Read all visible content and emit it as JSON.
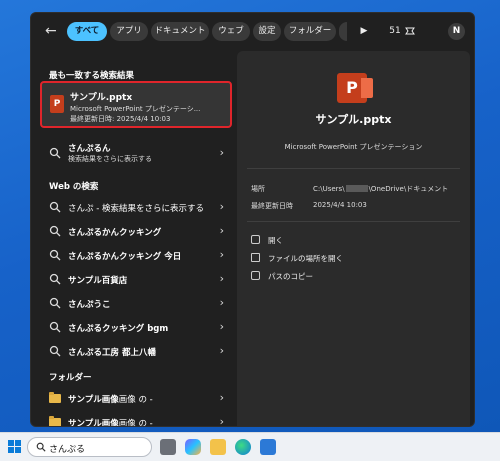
{
  "header": {
    "back_icon": "back-arrow-icon",
    "filters": [
      "すべて",
      "アプリ",
      "ドキュメント",
      "ウェブ",
      "設定",
      "フォルダー"
    ],
    "active_filter": "すべて",
    "points": "51",
    "avatar_initial": "N"
  },
  "best_match": {
    "heading": "最も一致する検索結果",
    "name": "サンプル.pptx",
    "type": "Microsoft PowerPoint プレゼンテーシ...",
    "modified": "最終更新日時: 2025/4/4 10:03"
  },
  "suggestion": {
    "query": "さんぷるん",
    "sub": "検索結果をさらに表示する"
  },
  "web": {
    "heading": "Web の検索",
    "items": [
      {
        "prefix": "さんぷ",
        "bold": "",
        "suffix": " - 検索結果をさらに表示する"
      },
      {
        "prefix": "",
        "bold": "さんぷるかんクッキング",
        "suffix": ""
      },
      {
        "prefix": "",
        "bold": "さんぷるかんクッキング 今日",
        "suffix": ""
      },
      {
        "prefix": "",
        "bold": "サンプル百貨店",
        "suffix": ""
      },
      {
        "prefix": "",
        "bold": "さんぷうこ",
        "suffix": ""
      },
      {
        "prefix": "",
        "bold": "さんぷるクッキング bgm",
        "suffix": ""
      },
      {
        "prefix": "",
        "bold": "さんぷる工房 都上八幡",
        "suffix": ""
      }
    ]
  },
  "folders": {
    "heading": "フォルダー",
    "items": [
      {
        "bold": "サンプル画像",
        "suffix": "画像 の -"
      },
      {
        "bold": "サンプル画像",
        "suffix": "画像 の -"
      }
    ]
  },
  "details": {
    "title": "サンプル.pptx",
    "subtitle": "Microsoft PowerPoint プレゼンテーション",
    "location_label": "場所",
    "location_prefix": "C:\\Users\\",
    "location_suffix": "\\OneDrive\\ドキュメント",
    "modified_label": "最終更新日時",
    "modified_value": "2025/4/4 10:03",
    "actions": [
      "開く",
      "ファイルの場所を開く",
      "パスのコピー"
    ]
  },
  "taskbar": {
    "search_value": "さんぷる"
  },
  "colors": {
    "accent": "#4cc2ff",
    "highlight_border": "#e0252b",
    "panel_bg": "#202020",
    "preview_bg": "#2b2b2b"
  }
}
